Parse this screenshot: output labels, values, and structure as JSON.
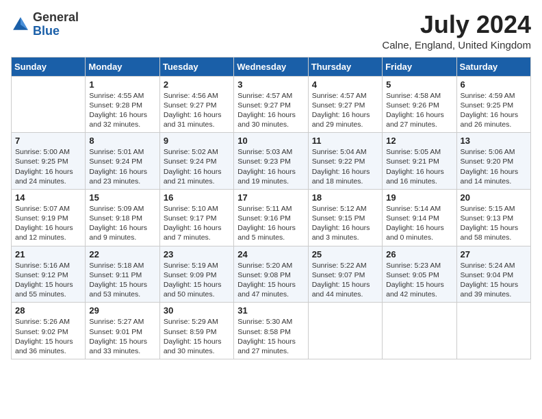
{
  "header": {
    "logo_general": "General",
    "logo_blue": "Blue",
    "month_title": "July 2024",
    "location": "Calne, England, United Kingdom"
  },
  "weekdays": [
    "Sunday",
    "Monday",
    "Tuesday",
    "Wednesday",
    "Thursday",
    "Friday",
    "Saturday"
  ],
  "weeks": [
    [
      {
        "day": "",
        "info": ""
      },
      {
        "day": "1",
        "info": "Sunrise: 4:55 AM\nSunset: 9:28 PM\nDaylight: 16 hours\nand 32 minutes."
      },
      {
        "day": "2",
        "info": "Sunrise: 4:56 AM\nSunset: 9:27 PM\nDaylight: 16 hours\nand 31 minutes."
      },
      {
        "day": "3",
        "info": "Sunrise: 4:57 AM\nSunset: 9:27 PM\nDaylight: 16 hours\nand 30 minutes."
      },
      {
        "day": "4",
        "info": "Sunrise: 4:57 AM\nSunset: 9:27 PM\nDaylight: 16 hours\nand 29 minutes."
      },
      {
        "day": "5",
        "info": "Sunrise: 4:58 AM\nSunset: 9:26 PM\nDaylight: 16 hours\nand 27 minutes."
      },
      {
        "day": "6",
        "info": "Sunrise: 4:59 AM\nSunset: 9:25 PM\nDaylight: 16 hours\nand 26 minutes."
      }
    ],
    [
      {
        "day": "7",
        "info": "Sunrise: 5:00 AM\nSunset: 9:25 PM\nDaylight: 16 hours\nand 24 minutes."
      },
      {
        "day": "8",
        "info": "Sunrise: 5:01 AM\nSunset: 9:24 PM\nDaylight: 16 hours\nand 23 minutes."
      },
      {
        "day": "9",
        "info": "Sunrise: 5:02 AM\nSunset: 9:24 PM\nDaylight: 16 hours\nand 21 minutes."
      },
      {
        "day": "10",
        "info": "Sunrise: 5:03 AM\nSunset: 9:23 PM\nDaylight: 16 hours\nand 19 minutes."
      },
      {
        "day": "11",
        "info": "Sunrise: 5:04 AM\nSunset: 9:22 PM\nDaylight: 16 hours\nand 18 minutes."
      },
      {
        "day": "12",
        "info": "Sunrise: 5:05 AM\nSunset: 9:21 PM\nDaylight: 16 hours\nand 16 minutes."
      },
      {
        "day": "13",
        "info": "Sunrise: 5:06 AM\nSunset: 9:20 PM\nDaylight: 16 hours\nand 14 minutes."
      }
    ],
    [
      {
        "day": "14",
        "info": "Sunrise: 5:07 AM\nSunset: 9:19 PM\nDaylight: 16 hours\nand 12 minutes."
      },
      {
        "day": "15",
        "info": "Sunrise: 5:09 AM\nSunset: 9:18 PM\nDaylight: 16 hours\nand 9 minutes."
      },
      {
        "day": "16",
        "info": "Sunrise: 5:10 AM\nSunset: 9:17 PM\nDaylight: 16 hours\nand 7 minutes."
      },
      {
        "day": "17",
        "info": "Sunrise: 5:11 AM\nSunset: 9:16 PM\nDaylight: 16 hours\nand 5 minutes."
      },
      {
        "day": "18",
        "info": "Sunrise: 5:12 AM\nSunset: 9:15 PM\nDaylight: 16 hours\nand 3 minutes."
      },
      {
        "day": "19",
        "info": "Sunrise: 5:14 AM\nSunset: 9:14 PM\nDaylight: 16 hours\nand 0 minutes."
      },
      {
        "day": "20",
        "info": "Sunrise: 5:15 AM\nSunset: 9:13 PM\nDaylight: 15 hours\nand 58 minutes."
      }
    ],
    [
      {
        "day": "21",
        "info": "Sunrise: 5:16 AM\nSunset: 9:12 PM\nDaylight: 15 hours\nand 55 minutes."
      },
      {
        "day": "22",
        "info": "Sunrise: 5:18 AM\nSunset: 9:11 PM\nDaylight: 15 hours\nand 53 minutes."
      },
      {
        "day": "23",
        "info": "Sunrise: 5:19 AM\nSunset: 9:09 PM\nDaylight: 15 hours\nand 50 minutes."
      },
      {
        "day": "24",
        "info": "Sunrise: 5:20 AM\nSunset: 9:08 PM\nDaylight: 15 hours\nand 47 minutes."
      },
      {
        "day": "25",
        "info": "Sunrise: 5:22 AM\nSunset: 9:07 PM\nDaylight: 15 hours\nand 44 minutes."
      },
      {
        "day": "26",
        "info": "Sunrise: 5:23 AM\nSunset: 9:05 PM\nDaylight: 15 hours\nand 42 minutes."
      },
      {
        "day": "27",
        "info": "Sunrise: 5:24 AM\nSunset: 9:04 PM\nDaylight: 15 hours\nand 39 minutes."
      }
    ],
    [
      {
        "day": "28",
        "info": "Sunrise: 5:26 AM\nSunset: 9:02 PM\nDaylight: 15 hours\nand 36 minutes."
      },
      {
        "day": "29",
        "info": "Sunrise: 5:27 AM\nSunset: 9:01 PM\nDaylight: 15 hours\nand 33 minutes."
      },
      {
        "day": "30",
        "info": "Sunrise: 5:29 AM\nSunset: 8:59 PM\nDaylight: 15 hours\nand 30 minutes."
      },
      {
        "day": "31",
        "info": "Sunrise: 5:30 AM\nSunset: 8:58 PM\nDaylight: 15 hours\nand 27 minutes."
      },
      {
        "day": "",
        "info": ""
      },
      {
        "day": "",
        "info": ""
      },
      {
        "day": "",
        "info": ""
      }
    ]
  ]
}
